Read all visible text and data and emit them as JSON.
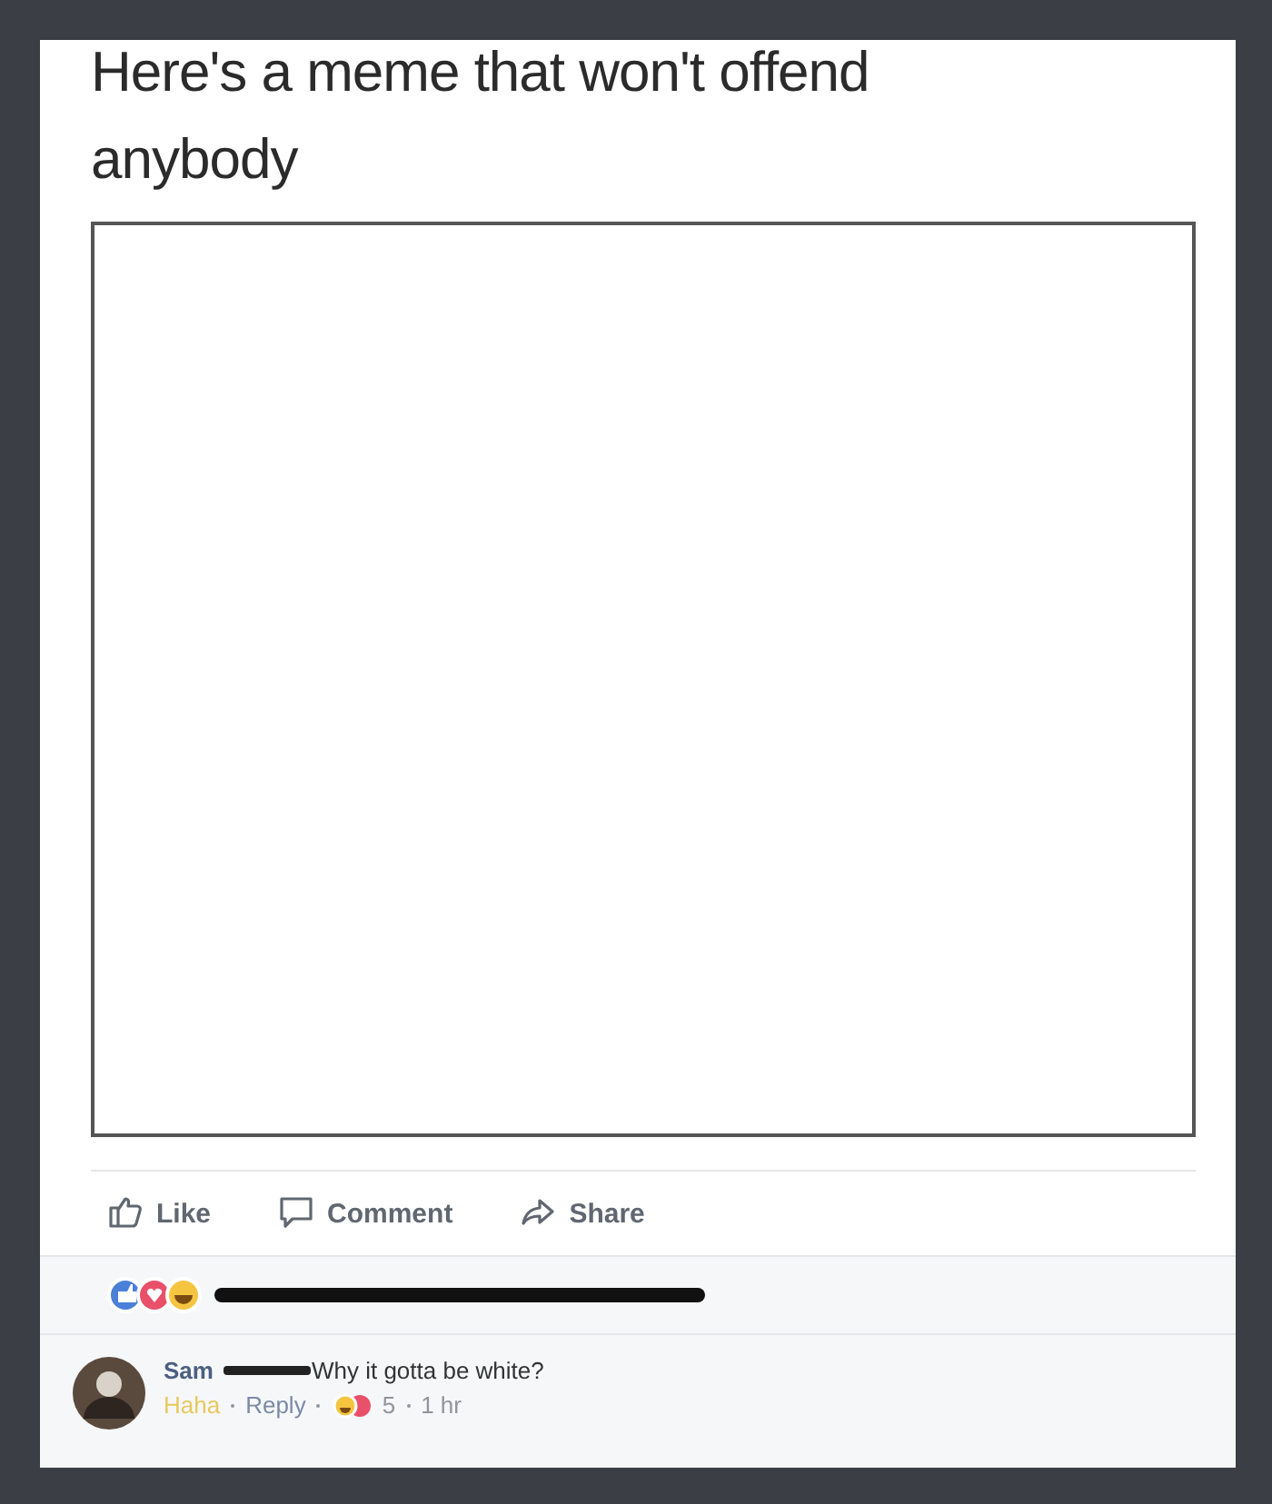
{
  "post": {
    "text": "Here's a meme that won't offend anybody"
  },
  "actions": [
    {
      "kind": "like",
      "label": "Like"
    },
    {
      "kind": "comment",
      "label": "Comment"
    },
    {
      "kind": "share",
      "label": "Share"
    }
  ],
  "comment": {
    "author": "Sam",
    "text": "Why it gotta be white?",
    "reaction": "Haha",
    "reply": "Reply",
    "count": "5",
    "time": "1 hr"
  }
}
